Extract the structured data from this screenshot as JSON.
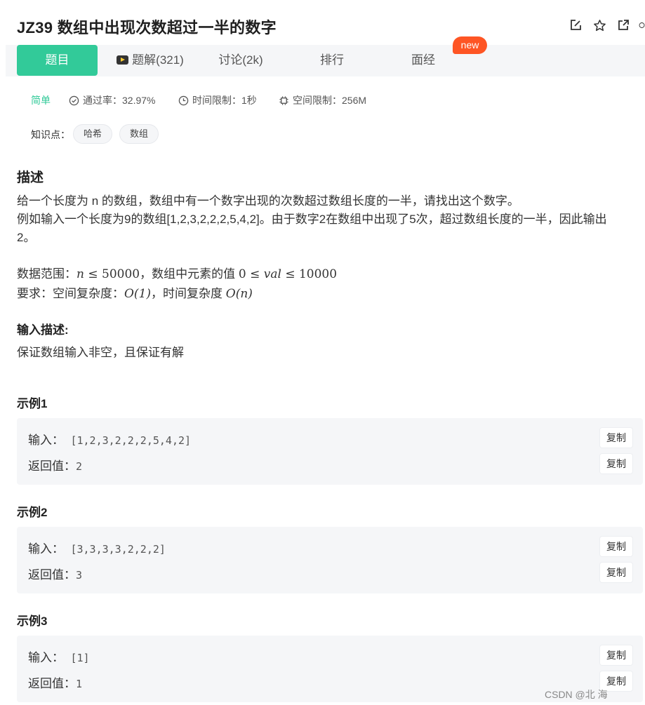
{
  "problem": {
    "title": "JZ39  数组中出现次数超过一半的数字"
  },
  "tabs": [
    {
      "label": "题目"
    },
    {
      "label": "题解(321)"
    },
    {
      "label": "讨论(2k)"
    },
    {
      "label": "排行"
    },
    {
      "label": "面经"
    }
  ],
  "new_badge": "new",
  "meta": {
    "difficulty": "简单",
    "pass_rate": "通过率：32.97%",
    "time_limit": "时间限制：1秒",
    "space_limit": "空间限制：256M"
  },
  "knowledge": {
    "label": "知识点：",
    "tags": [
      "哈希",
      "数组"
    ]
  },
  "description": {
    "heading": "描述",
    "line1": "给一个长度为 n 的数组，数组中有一个数字出现的次数超过数组长度的一半，请找出这个数字。",
    "line2": "例如输入一个长度为9的数组[1,2,3,2,2,2,5,4,2]。由于数字2在数组中出现了5次，超过数组长度的一半，因此输出",
    "line3": "2。",
    "range_prefix": "数据范围：",
    "range_n": "n",
    "range_leq1": " ≤ ",
    "range_max": "50000",
    "range_mid": "，数组中元素的值 ",
    "range_zero": "0",
    "range_leq2": " ≤ ",
    "range_val": "val",
    "range_leq3": " ≤ ",
    "range_valmax": "10000",
    "req_prefix": "要求：空间复杂度：",
    "req_space": "O(1)",
    "req_mid": "，时间复杂度 ",
    "req_time": "O(n)"
  },
  "input_desc": {
    "heading": "输入描述:",
    "text": "保证数组输入非空，且保证有解"
  },
  "examples": [
    {
      "heading": "示例1",
      "input_label": "输入：",
      "input": "[1,2,3,2,2,2,5,4,2]",
      "output_label": "返回值：",
      "output": "2"
    },
    {
      "heading": "示例2",
      "input_label": "输入：",
      "input": "[3,3,3,3,2,2,2]",
      "output_label": "返回值：",
      "output": "3"
    },
    {
      "heading": "示例3",
      "input_label": "输入：",
      "input": "[1]",
      "output_label": "返回值：",
      "output": "1"
    }
  ],
  "copy_label": "复制",
  "watermark": "CSDN @北 海",
  "colors": {
    "accent": "#32ca99",
    "badge": "#fe5524",
    "panel": "#f5f6f8"
  },
  "icons": [
    "edit-icon",
    "star-icon",
    "share-icon",
    "circle-icon",
    "video-icon",
    "check-circle-icon",
    "clock-icon",
    "chip-icon"
  ]
}
